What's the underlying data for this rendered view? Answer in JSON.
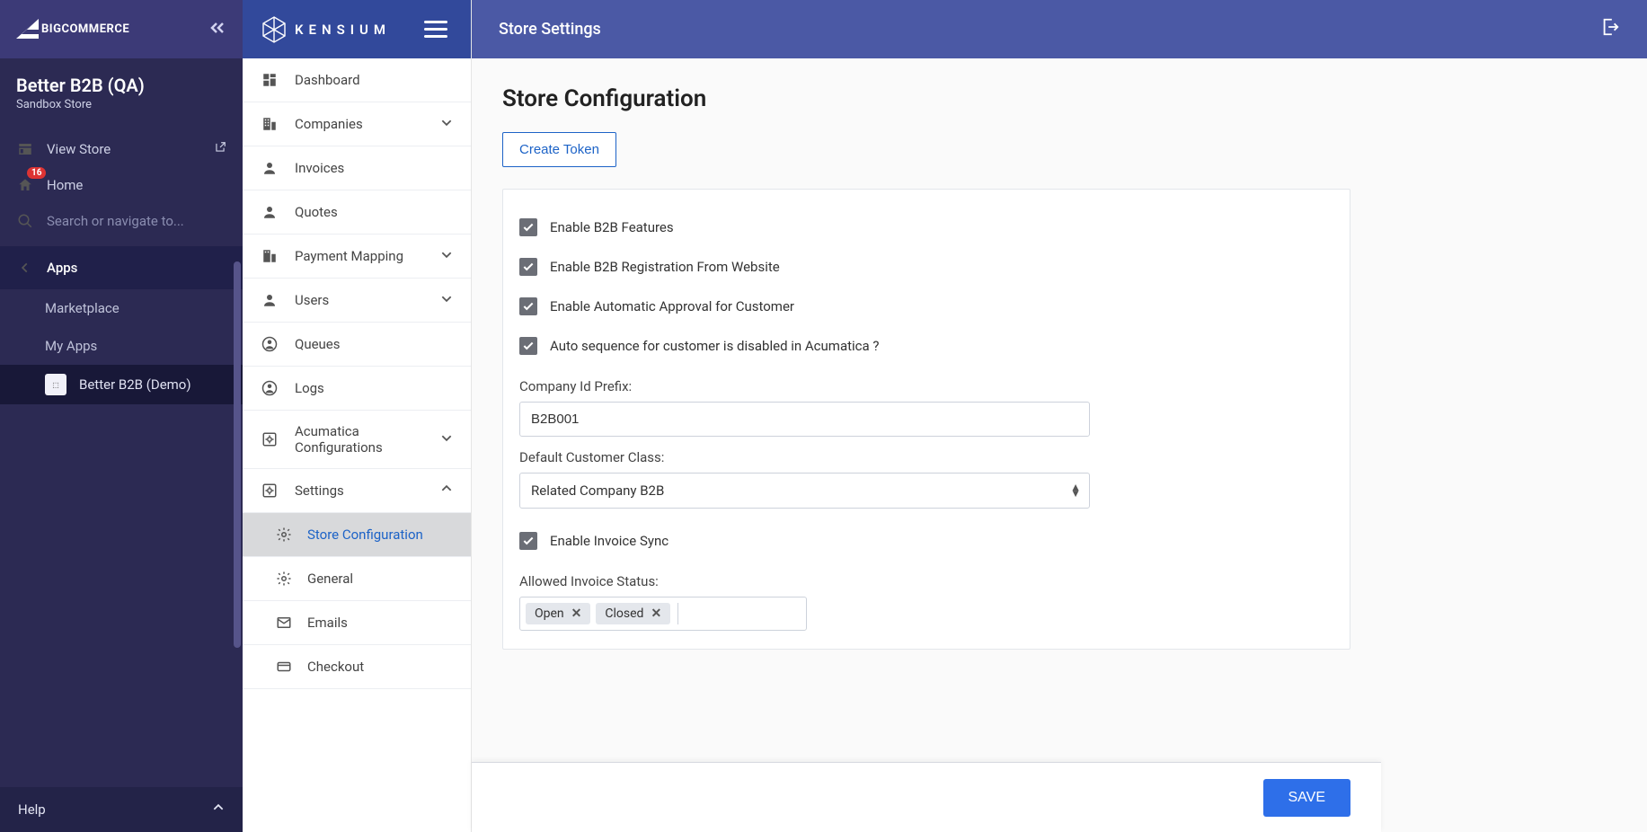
{
  "bc": {
    "platform": "BIGCOMMERCE",
    "store_name": "Better B2B (QA)",
    "store_subtitle": "Sandbox Store",
    "view_store": "View Store",
    "home": "Home",
    "home_badge": "16",
    "search_placeholder": "Search or navigate to...",
    "apps_header": "Apps",
    "marketplace": "Marketplace",
    "my_apps": "My Apps",
    "active_app": "Better B2B (Demo)",
    "help": "Help"
  },
  "kn": {
    "brand": "KENSIUM",
    "menu": {
      "dashboard": "Dashboard",
      "companies": "Companies",
      "invoices": "Invoices",
      "quotes": "Quotes",
      "payment_mapping": "Payment Mapping",
      "users": "Users",
      "queues": "Queues",
      "logs": "Logs",
      "acumatica": "Acumatica Configurations",
      "settings": "Settings",
      "store_config": "Store Configuration",
      "general": "General",
      "emails": "Emails",
      "checkout": "Checkout"
    }
  },
  "topbar": {
    "title": "Store Settings"
  },
  "form": {
    "heading": "Store Configuration",
    "create_token": "Create Token",
    "chk_b2b_features": "Enable B2B Features",
    "chk_b2b_reg": "Enable B2B Registration From Website",
    "chk_auto_approval": "Enable Automatic Approval for Customer",
    "chk_auto_sequence": "Auto sequence for customer is disabled in Acumatica ?",
    "company_prefix_label": "Company Id Prefix:",
    "company_prefix_value": "B2B001",
    "default_class_label": "Default Customer Class:",
    "default_class_value": "Related Company B2B",
    "chk_invoice_sync": "Enable Invoice Sync",
    "allowed_invoice_status_label": "Allowed Invoice Status:",
    "tags": {
      "open": "Open",
      "closed": "Closed"
    },
    "save": "SAVE"
  }
}
